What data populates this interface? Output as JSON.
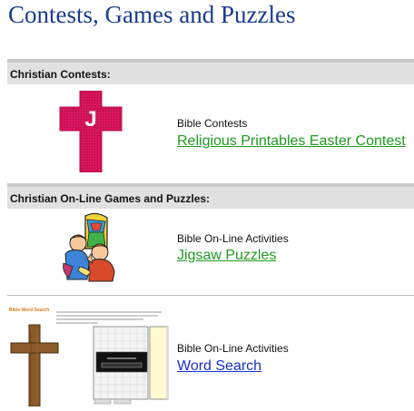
{
  "page": {
    "title": "Contests, Games and Puzzles"
  },
  "sections": [
    {
      "header": "Christian Contests:",
      "entries": [
        {
          "category": "Bible Contests",
          "link": "Religious Printables Easter Contest",
          "icon": "j-cross-icon",
          "icon_letter": "J"
        }
      ]
    },
    {
      "header": "Christian On-Line Games and Puzzles:",
      "entries": [
        {
          "category": "Bible On-Line Activities",
          "link": "Jigsaw Puzzles",
          "icon": "children-praying-icon"
        }
      ]
    },
    {
      "entries": [
        {
          "category": "Bible On-Line Activities",
          "link": "Word Search",
          "icon": "word-search-thumbnail",
          "thumb_title": "Bible Word Search"
        }
      ]
    }
  ],
  "colors": {
    "title": "#1a3a8c",
    "link_green": "#1f9a1f",
    "link_blue": "#1a2fcc",
    "cross_pink": "#d8145a"
  }
}
